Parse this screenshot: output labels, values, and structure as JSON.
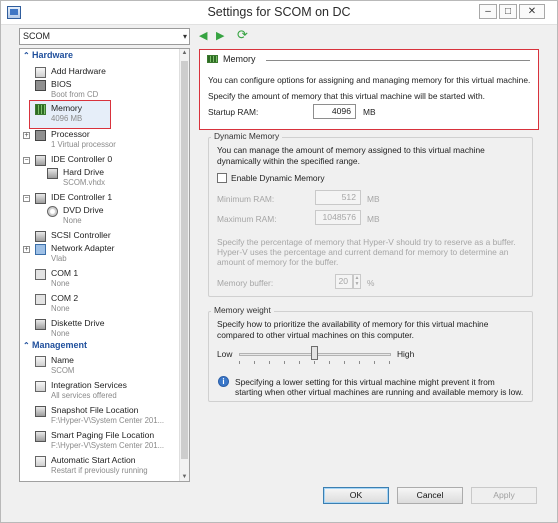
{
  "window": {
    "title": "Settings for SCOM on DC",
    "min": "–",
    "max": "□",
    "close": "✕"
  },
  "vm_select": {
    "value": "SCOM",
    "arrow": "▾"
  },
  "nav": {
    "back": "◀",
    "forward": "▶",
    "refresh": "⟳"
  },
  "tree": {
    "hardware_header": "Hardware",
    "management_header": "Management",
    "items": [
      {
        "label": "Add Hardware",
        "sub": ""
      },
      {
        "label": "BIOS",
        "sub": "Boot from CD"
      },
      {
        "label": "Memory",
        "sub": "4096 MB"
      },
      {
        "label": "Processor",
        "sub": "1 Virtual processor"
      },
      {
        "label": "IDE Controller 0",
        "sub": ""
      },
      {
        "label": "Hard Drive",
        "sub": "SCOM.vhdx"
      },
      {
        "label": "IDE Controller 1",
        "sub": ""
      },
      {
        "label": "DVD Drive",
        "sub": "None"
      },
      {
        "label": "SCSI Controller",
        "sub": ""
      },
      {
        "label": "Network Adapter",
        "sub": "Vlab"
      },
      {
        "label": "COM 1",
        "sub": "None"
      },
      {
        "label": "COM 2",
        "sub": "None"
      },
      {
        "label": "Diskette Drive",
        "sub": "None"
      }
    ],
    "mgmt_items": [
      {
        "label": "Name",
        "sub": "SCOM"
      },
      {
        "label": "Integration Services",
        "sub": "All services offered"
      },
      {
        "label": "Snapshot File Location",
        "sub": "F:\\Hyper-V\\System Center 201..."
      },
      {
        "label": "Smart Paging File Location",
        "sub": "F:\\Hyper-V\\System Center 201..."
      },
      {
        "label": "Automatic Start Action",
        "sub": "Restart if previously running"
      }
    ]
  },
  "memory": {
    "section_title": "Memory",
    "desc1": "You can configure options for assigning and managing memory for this virtual machine.",
    "desc2": "Specify the amount of memory that this virtual machine will be started with.",
    "startup_label": "Startup RAM:",
    "startup_value": "4096",
    "unit": "MB"
  },
  "dynamic": {
    "title": "Dynamic Memory",
    "desc1": "You can manage the amount of memory assigned to this virtual machine",
    "desc2": "dynamically within the specified range.",
    "enable_label": "Enable Dynamic Memory",
    "min_label": "Minimum RAM:",
    "min_value": "512",
    "max_label": "Maximum RAM:",
    "max_value": "1048576",
    "unit": "MB",
    "buffer_desc1": "Specify the percentage of memory that Hyper-V should try to reserve as a buffer.",
    "buffer_desc2": "Hyper-V uses the percentage and current demand for memory to determine an",
    "buffer_desc3": "amount of memory for the buffer.",
    "buffer_label": "Memory buffer:",
    "buffer_value": "20",
    "buffer_unit": "%"
  },
  "weight": {
    "title": "Memory weight",
    "desc1": "Specify how to prioritize the availability of memory for this virtual machine",
    "desc2": "compared to other virtual machines on this computer.",
    "low": "Low",
    "high": "High",
    "level": 0.5,
    "note1": "Specifying a lower setting for this virtual machine might prevent it from",
    "note2": "starting when other virtual machines are running and available memory is low.",
    "info_glyph": "i"
  },
  "buttons": {
    "ok": "OK",
    "cancel": "Cancel",
    "apply": "Apply"
  }
}
